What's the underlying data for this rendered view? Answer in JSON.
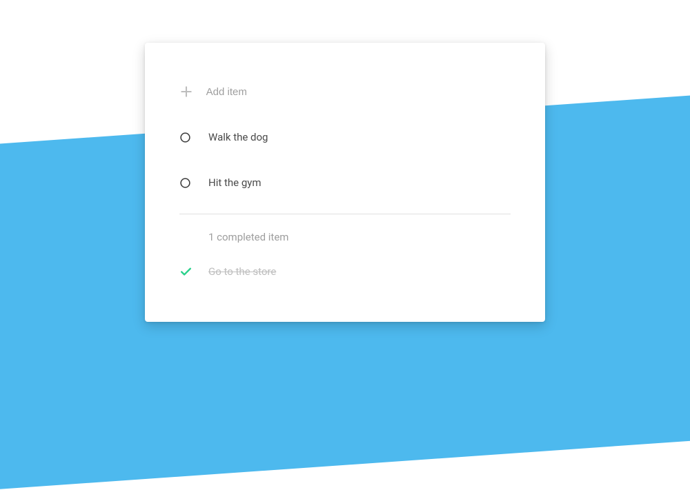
{
  "addItem": {
    "placeholder": "Add item"
  },
  "todos": [
    {
      "label": "Walk the dog"
    },
    {
      "label": "Hit the gym"
    }
  ],
  "completedHeader": "1 completed item",
  "completed": [
    {
      "label": "Go to the store"
    }
  ],
  "colors": {
    "accent": "#4db9ee",
    "check": "#29d18b",
    "textMuted": "#9e9e9e",
    "textStruck": "#bdbdbd"
  }
}
